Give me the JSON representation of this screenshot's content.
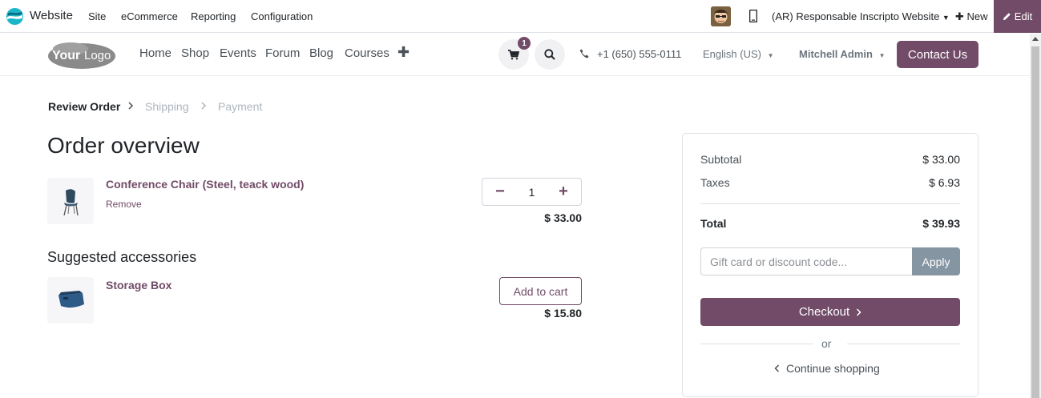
{
  "admin_bar": {
    "app_name": "Website",
    "menus": [
      "Site",
      "eCommerce",
      "Reporting",
      "Configuration"
    ],
    "website_switch": "(AR) Responsable Inscripto Website",
    "new_label": "New",
    "edit_label": "Edit"
  },
  "site_header": {
    "logo_text": "YourLogo",
    "nav": [
      "Home",
      "Shop",
      "Events",
      "Forum",
      "Blog",
      "Courses"
    ],
    "cart_count": "1",
    "phone": "+1 (650) 555-0111",
    "language": "English (US)",
    "user": "Mitchell Admin",
    "contact_label": "Contact Us"
  },
  "steps": [
    "Review Order",
    "Shipping",
    "Payment"
  ],
  "order": {
    "title": "Order overview",
    "lines": [
      {
        "name": "Conference Chair (Steel, teack wood)",
        "remove_label": "Remove",
        "quantity": "1",
        "price": "$ 33.00"
      }
    ],
    "accessories_title": "Suggested accessories",
    "accessories": [
      {
        "name": "Storage Box",
        "button_label": "Add to cart",
        "price": "$ 15.80"
      }
    ]
  },
  "summary": {
    "subtotal_label": "Subtotal",
    "subtotal": "$ 33.00",
    "taxes_label": "Taxes",
    "taxes": "$ 6.93",
    "total_label": "Total",
    "total": "$ 39.93",
    "coupon_placeholder": "Gift card or discount code...",
    "apply_label": "Apply",
    "checkout_label": "Checkout",
    "or_label": "or",
    "continue_label": "Continue shopping"
  },
  "colors": {
    "brand": "#714b67",
    "apply": "#8595a2"
  }
}
